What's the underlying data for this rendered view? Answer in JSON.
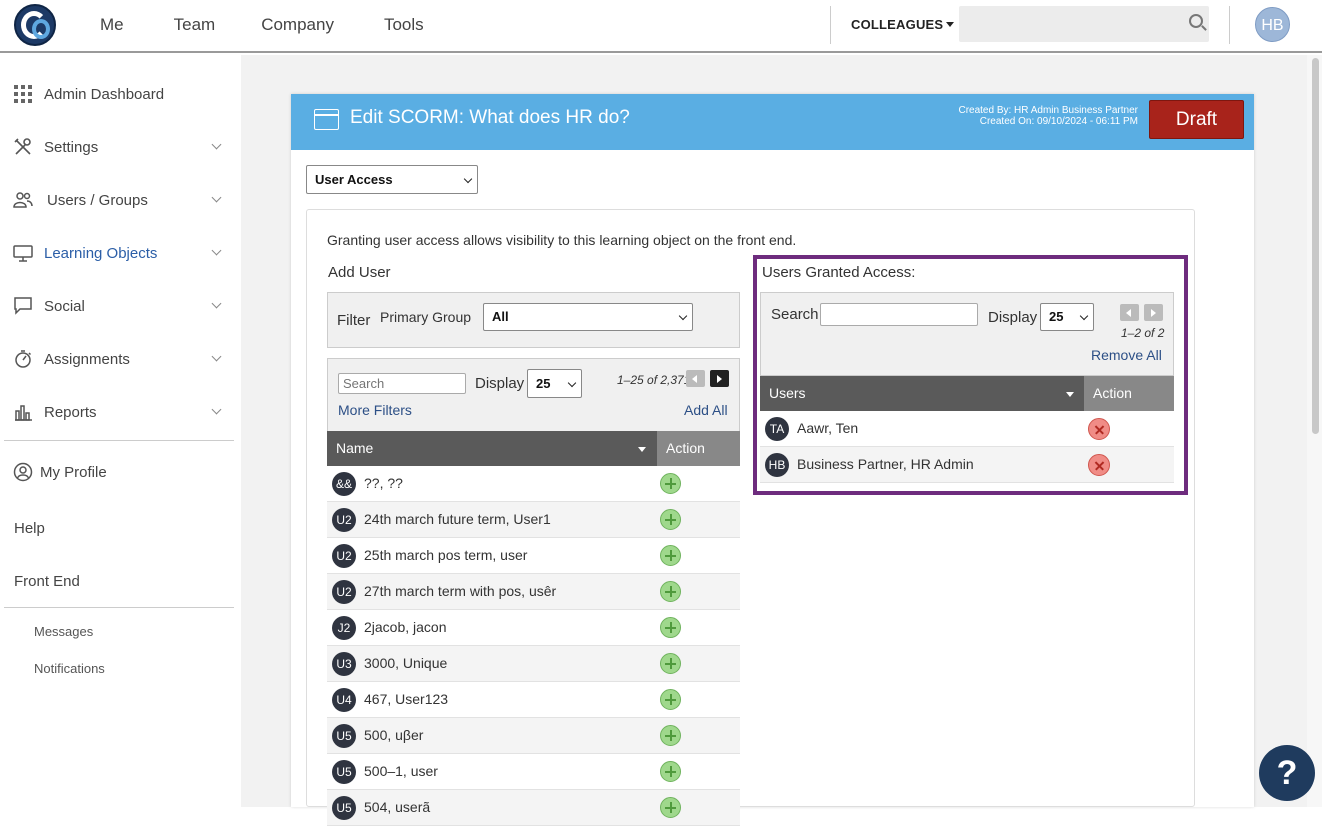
{
  "topnav": {
    "items": [
      "Me",
      "Team",
      "Company",
      "Tools"
    ],
    "colleagues_label": "COLLEAGUES",
    "search_placeholder": "",
    "avatar_initials": "HB"
  },
  "sidebar": {
    "items": [
      {
        "label": "Admin Dashboard",
        "icon": "grid-icon",
        "chevron": false
      },
      {
        "label": "Settings",
        "icon": "tools-icon",
        "chevron": true
      },
      {
        "label": "Users / Groups",
        "icon": "users-icon",
        "chevron": true
      },
      {
        "label": "Learning Objects",
        "icon": "monitor-icon",
        "chevron": true,
        "active": true
      },
      {
        "label": "Social",
        "icon": "chat-icon",
        "chevron": true
      },
      {
        "label": "Assignments",
        "icon": "stopwatch-icon",
        "chevron": true
      },
      {
        "label": "Reports",
        "icon": "bar-chart-icon",
        "chevron": true
      }
    ],
    "my_profile": "My Profile",
    "help": "Help",
    "front_end": "Front End",
    "messages": "Messages",
    "notifications": "Notifications"
  },
  "header": {
    "title": "Edit SCORM: What does HR do?",
    "created_by": "Created By: HR Admin Business Partner",
    "created_on": "Created On: 09/10/2024 - 06:11 PM",
    "status_button": "Draft"
  },
  "tab_select": {
    "value": "User Access"
  },
  "intro_text": "Granting user access allows visibility to this learning object on the front end.",
  "add_user": {
    "title": "Add User",
    "filter_label": "Filter",
    "primary_group_label": "Primary Group",
    "primary_group_value": "All",
    "search_placeholder": "Search",
    "display_label": "Display",
    "display_value": "25",
    "pager_text": "1–25 of 2,371",
    "more_filters": "More Filters",
    "add_all": "Add All",
    "col_name": "Name",
    "col_action": "Action",
    "rows": [
      {
        "initials": "&&",
        "name": "??, ??"
      },
      {
        "initials": "U2",
        "name": "24th march future term, User1"
      },
      {
        "initials": "U2",
        "name": "25th march pos term, user"
      },
      {
        "initials": "U2",
        "name": "27th march term with pos, usêr"
      },
      {
        "initials": "J2",
        "name": "2jacob, jacon"
      },
      {
        "initials": "U3",
        "name": "3000, Unique"
      },
      {
        "initials": "U4",
        "name": "467, User123"
      },
      {
        "initials": "U5",
        "name": "500, uβer"
      },
      {
        "initials": "U5",
        "name": "500–1, user"
      },
      {
        "initials": "U5",
        "name": "504, userã"
      }
    ]
  },
  "granted": {
    "title": "Users Granted Access:",
    "search_label": "Search",
    "search_value": "",
    "display_label": "Display",
    "display_value": "25",
    "pager_text": "1–2 of 2",
    "remove_all": "Remove All",
    "col_users": "Users",
    "col_action": "Action",
    "rows": [
      {
        "initials": "TA",
        "name": "Aawr, Ten"
      },
      {
        "initials": "HB",
        "name": "Business Partner, HR Admin"
      }
    ]
  },
  "help_button": "?",
  "colors": {
    "header_blue": "#5aaee3",
    "draft_red": "#a8231b",
    "highlight_purple": "#6e2c7e",
    "table_header": "#5a5a5a",
    "link_blue": "#2c4f86"
  }
}
